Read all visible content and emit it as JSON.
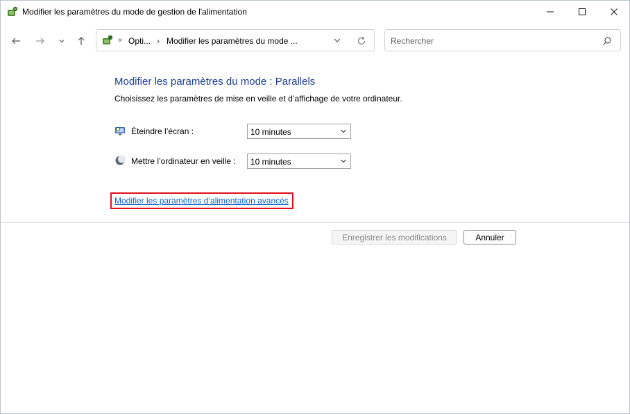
{
  "window": {
    "title": "Modifier les paramètres du mode de gestion de l'alimentation",
    "icons": {
      "app": "power-options-icon",
      "minimize": "minimize-icon",
      "maximize": "maximize-icon",
      "close": "close-icon"
    }
  },
  "nav": {
    "back": "back-arrow-icon",
    "forward": "forward-arrow-icon",
    "recent": "chevron-down-icon",
    "up": "up-arrow-icon"
  },
  "address": {
    "separator": "«",
    "crumb1": "Opti...",
    "arrow": "›",
    "crumb2": "Modifier les paramètres du mode ..."
  },
  "search": {
    "placeholder": "Rechercher"
  },
  "content": {
    "heading": "Modifier les paramètres du mode : Parallels",
    "subtext": "Choisissez les paramètres de mise en veille et d’affichage de votre ordinateur.",
    "rows": [
      {
        "label": "Éteindre l’écran :",
        "value": "10 minutes",
        "icon": "display-icon"
      },
      {
        "label": "Mettre l’ordinateur en veille :",
        "value": "10 minutes",
        "icon": "sleep-moon-icon"
      }
    ],
    "advanced_link": "Modifier les paramètres d’alimentation avancés"
  },
  "buttons": {
    "save": "Enregistrer les modifications",
    "cancel": "Annuler"
  },
  "colors": {
    "heading": "#1e3f91",
    "link": "#0b62c9",
    "highlight": "#e0101a"
  }
}
